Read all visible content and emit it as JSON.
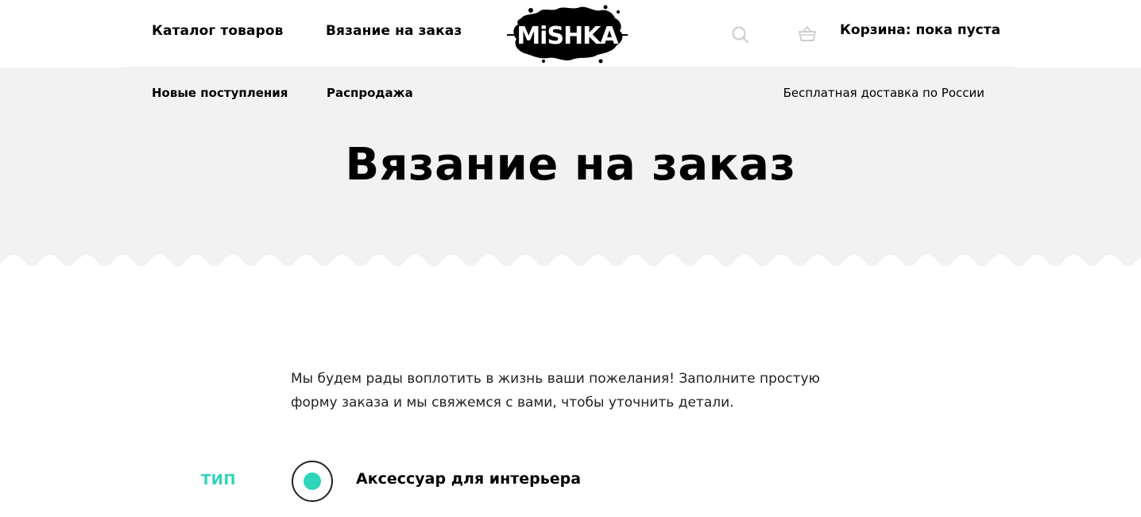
{
  "header": {
    "nav": {
      "catalog": "Каталог товаров",
      "custom_knitting": "Вязание на заказ"
    },
    "logo_text": "MiSHKA",
    "cart_label": "Корзина: пока пуста",
    "icons": {
      "search": "search-icon",
      "cart": "cart-icon"
    }
  },
  "subnav": {
    "new_arrivals": "Новые поступления",
    "sale": "Распродажа",
    "delivery": "Бесплатная доставка по России"
  },
  "page": {
    "title": "Вязание на заказ",
    "intro": "Мы будем рады воплотить в жизнь ваши пожелания! Заполните простую форму заказа и мы свяжемся с вами, чтобы уточнить детали."
  },
  "form": {
    "type_label": "ТИП",
    "options": [
      {
        "label": "Аксессуар для интерьера",
        "selected": true
      }
    ]
  },
  "colors": {
    "accent": "#2fd5b8",
    "hero_bg": "#f2f2f2",
    "text": "#000000"
  }
}
